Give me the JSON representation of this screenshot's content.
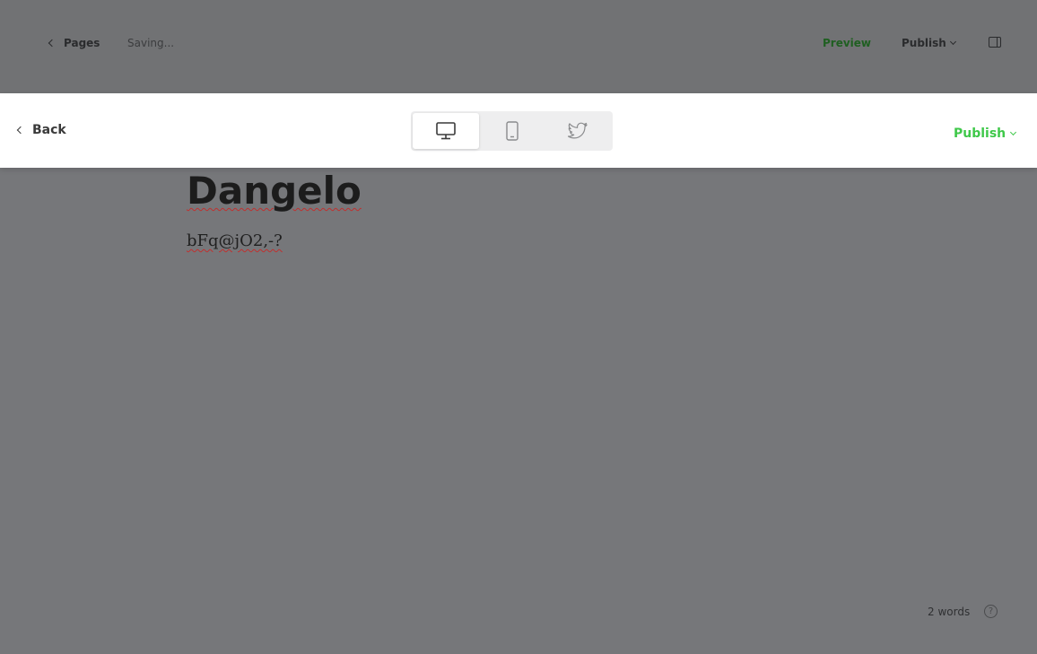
{
  "topbar": {
    "back_label": "Pages",
    "status": "Saving...",
    "preview_label": "Preview",
    "publish_label": "Publish"
  },
  "preview_bar": {
    "back_label": "Back",
    "devices": [
      "desktop",
      "mobile",
      "twitter"
    ],
    "active_device": "desktop",
    "publish_label": "Publish",
    "publish_color": "#3fc84a"
  },
  "post": {
    "title": "Dangelo",
    "body": "bFq@jO2,-?"
  },
  "footer": {
    "word_count": "2 words",
    "help_glyph": "?"
  },
  "colors": {
    "overlay": "#76777a",
    "preview_link": "#1f5f21",
    "accent_green": "#3fc84a"
  }
}
